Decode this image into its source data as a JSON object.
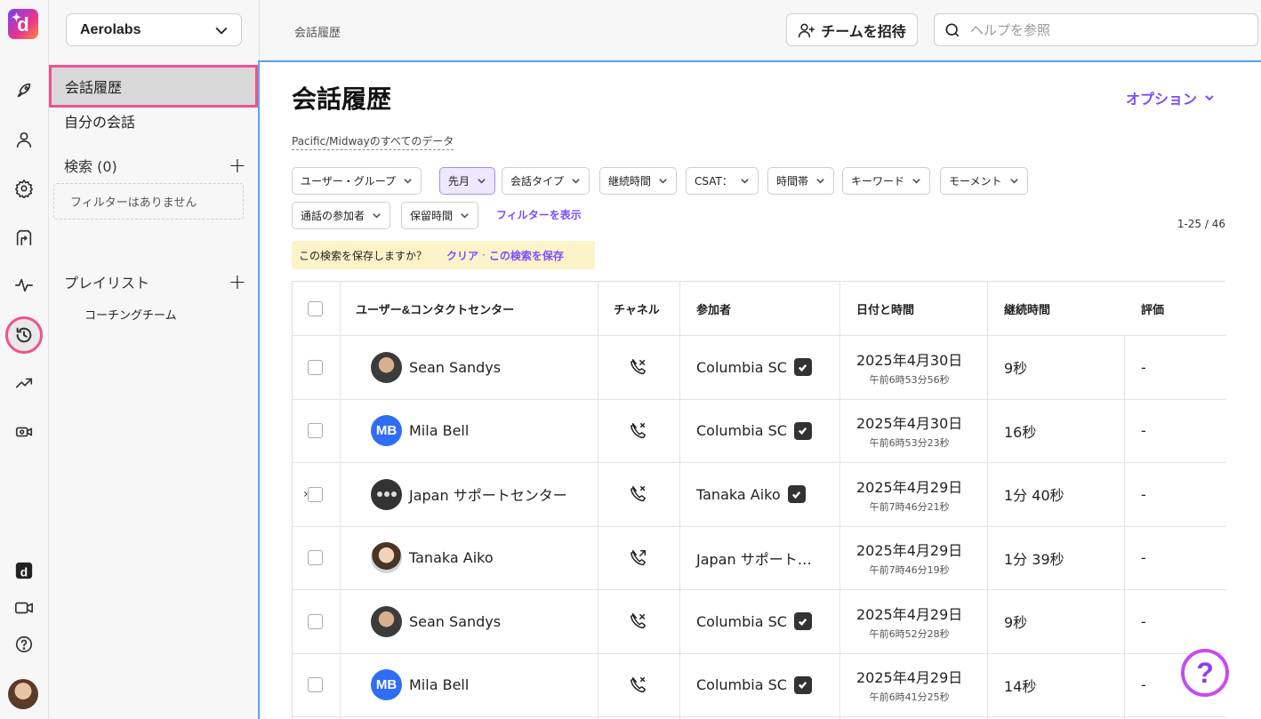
{
  "rail": {
    "logo_letter": "d",
    "icons": [
      "rocket-icon",
      "person-icon",
      "gear-icon",
      "routing-icon",
      "activity-icon",
      "history-icon",
      "trending-icon",
      "video-settings-icon",
      "dialpad-logo-icon",
      "video-icon",
      "help-icon",
      "avatar"
    ]
  },
  "sidebar": {
    "workspace": "Aerolabs",
    "items": [
      {
        "label": "会話履歴",
        "selected": true
      },
      {
        "label": "自分の会話",
        "selected": false
      }
    ],
    "search_section": "検索 (0)",
    "no_filters": "フィルターはありません",
    "playlist_section": "プレイリスト",
    "playlists": [
      "コーチングチーム"
    ]
  },
  "topbar": {
    "breadcrumb": "会話履歴",
    "invite_label": "チームを招待",
    "search_placeholder": "ヘルプを参照"
  },
  "main": {
    "title": "会話履歴",
    "options_label": "オプション",
    "timezone_note": "Pacific/Midwayのすべてのデータ",
    "filters": [
      {
        "label": "ユーザー・グループ",
        "active": false
      },
      {
        "label": "先月",
        "active": true
      },
      {
        "label": "会話タイプ",
        "active": false
      },
      {
        "label": "継続時間",
        "active": false
      },
      {
        "label": "CSAT：",
        "active": false
      },
      {
        "label": "時間帯",
        "active": false
      },
      {
        "label": "キーワード",
        "active": false
      },
      {
        "label": "モーメント",
        "active": false
      },
      {
        "label": "通話の参加者",
        "active": false
      },
      {
        "label": "保留時間",
        "active": false
      }
    ],
    "show_filters": "フィルターを表示",
    "pagination": "1-25 / 46",
    "save_prompt": "この検索を保存しますか？",
    "clear_label": "クリア",
    "save_sep": "·",
    "save_label": "この検索を保存"
  },
  "table": {
    "headers": {
      "user": "ユーザー&コンタクトセンター",
      "channel": "チャネル",
      "participant": "参加者",
      "datetime": "日付と時間",
      "duration": "継続時間",
      "rating": "評価"
    },
    "rows": [
      {
        "avatar": "photo1",
        "initials": "",
        "user": "Sean Sandys",
        "expandable": false,
        "channel": "incoming-missed",
        "participant": "Columbia SC",
        "verified": true,
        "date": "2025年4月30日",
        "time": "午前6時53分56秒",
        "duration": "9秒",
        "rating": "-"
      },
      {
        "avatar": "mb",
        "initials": "MB",
        "user": "Mila Bell",
        "expandable": false,
        "channel": "missed",
        "participant": "Columbia SC",
        "verified": true,
        "date": "2025年4月30日",
        "time": "午前6時53分23秒",
        "duration": "16秒",
        "rating": "-"
      },
      {
        "avatar": "group",
        "initials": "",
        "user": "Japan サポートセンター",
        "expandable": true,
        "channel": "missed",
        "participant": "Tanaka Aiko",
        "verified": true,
        "date": "2025年4月29日",
        "time": "午前7時46分21秒",
        "duration": "1分 40秒",
        "rating": "-"
      },
      {
        "avatar": "photo2",
        "initials": "",
        "user": "Tanaka Aiko",
        "expandable": false,
        "channel": "outgoing",
        "participant": "Japan サポート…",
        "verified": false,
        "date": "2025年4月29日",
        "time": "午前7時46分19秒",
        "duration": "1分 39秒",
        "rating": "-"
      },
      {
        "avatar": "photo1",
        "initials": "",
        "user": "Sean Sandys",
        "expandable": false,
        "channel": "incoming-missed",
        "participant": "Columbia SC",
        "verified": true,
        "date": "2025年4月29日",
        "time": "午前6時52分28秒",
        "duration": "9秒",
        "rating": "-"
      },
      {
        "avatar": "mb",
        "initials": "MB",
        "user": "Mila Bell",
        "expandable": false,
        "channel": "missed",
        "participant": "Columbia SC",
        "verified": true,
        "date": "2025年4月29日",
        "time": "午前6時41分25秒",
        "duration": "14秒",
        "rating": "-"
      }
    ]
  },
  "help_fab": "?",
  "colors": {
    "accent": "#7c4dff",
    "highlight": "#f0528f",
    "panel_border": "#5aa6e8"
  }
}
